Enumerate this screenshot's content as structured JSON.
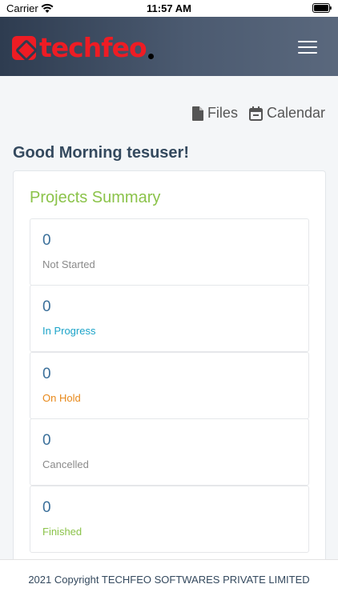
{
  "status_bar": {
    "carrier": "Carrier",
    "time": "11:57 AM"
  },
  "header": {
    "logo_text": "techfeo",
    "brand_color": "#ee1c24",
    "menu_icon": "hamburger-menu-icon"
  },
  "top_links": [
    {
      "label": "Files",
      "icon": "file-icon"
    },
    {
      "label": "Calendar",
      "icon": "calendar-icon"
    }
  ],
  "greeting": "Good Morning tesuser!",
  "projects_summary": {
    "title": "Projects Summary",
    "items": [
      {
        "count": "0",
        "label": "Not Started",
        "color": "#8a8a8a"
      },
      {
        "count": "0",
        "label": "In Progress",
        "color": "#1aa3c8"
      },
      {
        "count": "0",
        "label": "On Hold",
        "color": "#e8891a"
      },
      {
        "count": "0",
        "label": "Cancelled",
        "color": "#8a8a8a"
      },
      {
        "count": "0",
        "label": "Finished",
        "color": "#8bc34a"
      }
    ]
  },
  "footer": {
    "copyright": "2021 Copyright TECHFEO SOFTWARES PRIVATE LIMITED"
  }
}
